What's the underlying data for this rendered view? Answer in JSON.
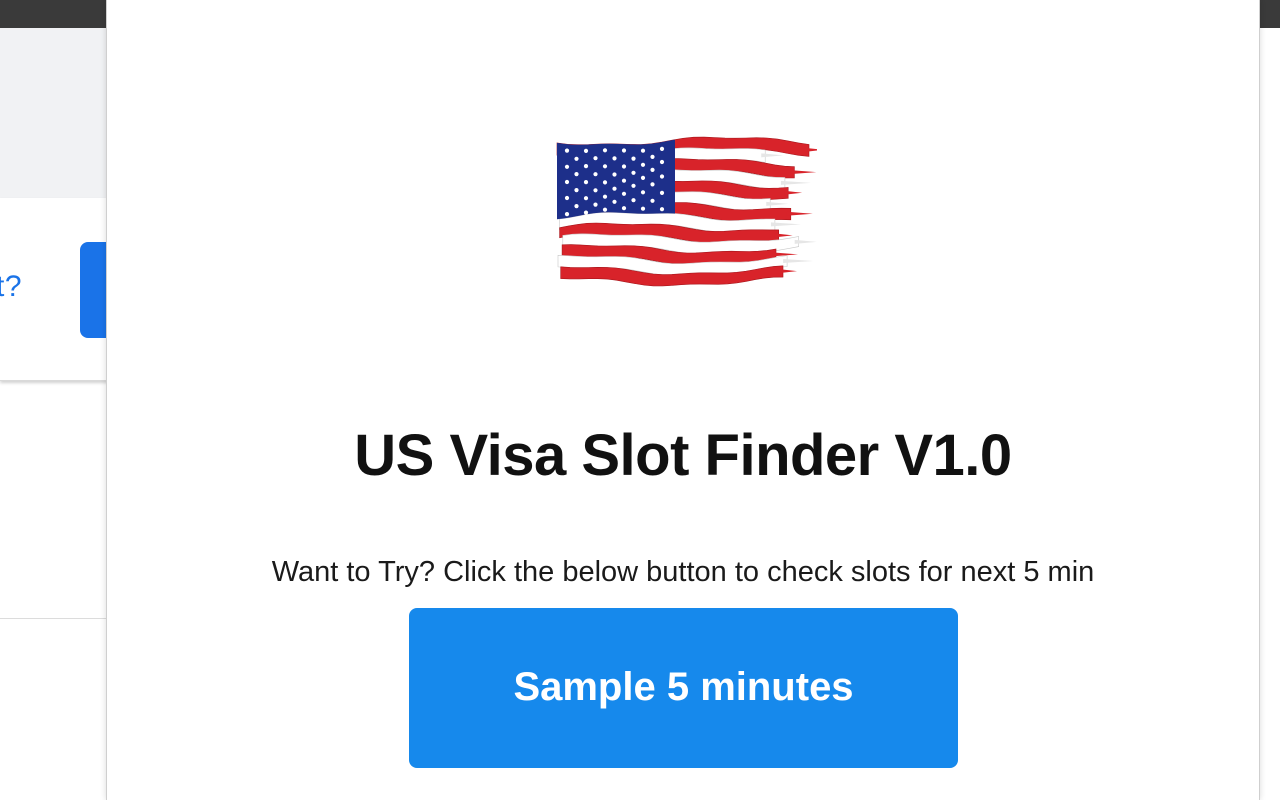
{
  "background_page": {
    "link_text": "t?"
  },
  "popup": {
    "logo": {
      "icon": "us-flag-icon",
      "colors": {
        "red": "#d8232a",
        "white": "#ffffff",
        "blue": "#1d2f8a"
      }
    },
    "title": "US Visa Slot Finder V1.0",
    "description": "Want to Try? Click the below button to check slots for next 5 min",
    "cta_label": "Sample 5 minutes",
    "cta_color": "#1689ec"
  }
}
